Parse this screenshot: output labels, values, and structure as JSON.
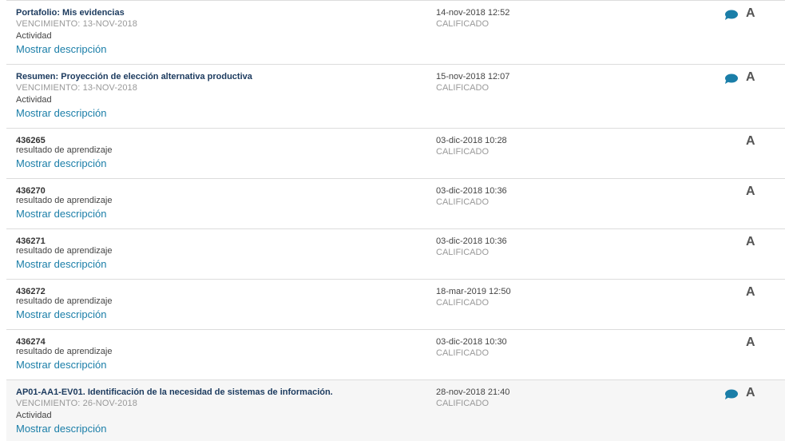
{
  "rows": [
    {
      "title": "Portafolio: Mis evidencias",
      "due": "VENCIMIENTO: 13-NOV-2018",
      "type": "Actividad",
      "desc": "Mostrar descripción",
      "date": "14-nov-2018 12:52",
      "status": "CALIFICADO",
      "grade": "A",
      "comment": true
    },
    {
      "title": "Resumen: Proyección de elección alternativa productiva",
      "due": "VENCIMIENTO: 13-NOV-2018",
      "type": "Actividad",
      "desc": "Mostrar descripción",
      "date": "15-nov-2018 12:07",
      "status": "CALIFICADO",
      "grade": "A",
      "comment": true
    },
    {
      "title": "436265",
      "type": "resultado de aprendizaje",
      "desc": "Mostrar descripción",
      "date": "03-dic-2018 10:28",
      "status": "CALIFICADO",
      "grade": "A",
      "comment": false
    },
    {
      "title": "436270",
      "type": "resultado de aprendizaje",
      "desc": "Mostrar descripción",
      "date": "03-dic-2018 10:36",
      "status": "CALIFICADO",
      "grade": "A",
      "comment": false
    },
    {
      "title": "436271",
      "type": "resultado de aprendizaje",
      "desc": "Mostrar descripción",
      "date": "03-dic-2018 10:36",
      "status": "CALIFICADO",
      "grade": "A",
      "comment": false
    },
    {
      "title": "436272",
      "type": "resultado de aprendizaje",
      "desc": "Mostrar descripción",
      "date": "18-mar-2019 12:50",
      "status": "CALIFICADO",
      "grade": "A",
      "comment": false
    },
    {
      "title": "436274",
      "type": "resultado de aprendizaje",
      "desc": "Mostrar descripción",
      "date": "03-dic-2018 10:30",
      "status": "CALIFICADO",
      "grade": "A",
      "comment": false
    },
    {
      "title": "AP01-AA1-EV01. Identificación de la necesidad de sistemas de información.",
      "due": "VENCIMIENTO: 26-NOV-2018",
      "type": "Actividad",
      "desc": "Mostrar descripción",
      "date": "28-nov-2018 21:40",
      "status": "CALIFICADO",
      "grade": "A",
      "comment": true
    }
  ],
  "colors": {
    "link": "#1a7ea8",
    "title": "#1b3a5e",
    "comment_icon": "#1a7ea8",
    "muted": "#999999"
  },
  "icons": {
    "comment": "comment-bubble-icon"
  }
}
